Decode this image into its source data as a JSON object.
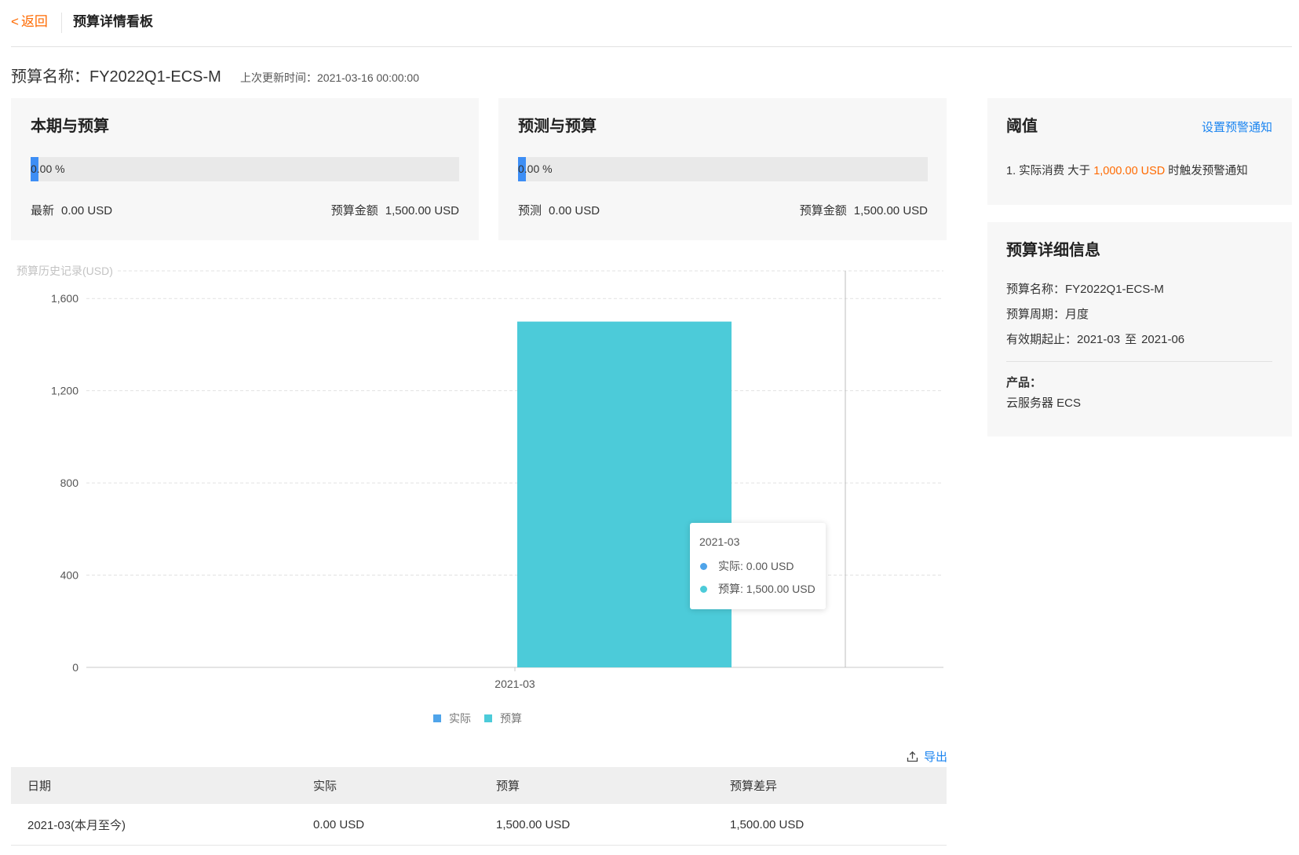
{
  "colors": {
    "brand_orange": "#ff6a00",
    "link_blue": "#1a84f0",
    "progress_blue": "#3d8ef5",
    "series_actual": "#4fa4ea",
    "series_budget": "#4ccbd9"
  },
  "header": {
    "back_chevron": "<",
    "back_label": "返回",
    "title": "预算详情看板"
  },
  "budget_summary": {
    "name_label": "预算名称：",
    "name": "FY2022Q1-ECS-M",
    "updated_label": "上次更新时间：",
    "updated_at": "2021-03-16 00:00:00"
  },
  "current_vs_budget": {
    "title": "本期与预算",
    "progress_percent": 0,
    "progress_text": "0.00 %",
    "left_label": "最新",
    "left_value": "0.00 USD",
    "right_label": "预算金额",
    "right_value": "1,500.00 USD"
  },
  "forecast_vs_budget": {
    "title": "预测与预算",
    "progress_percent": 0,
    "progress_text": "0.00 %",
    "left_label": "预测",
    "left_value": "0.00 USD",
    "right_label": "预算金额",
    "right_value": "1,500.00 USD"
  },
  "threshold": {
    "title": "阈值",
    "set_alert_link": "设置预警通知",
    "rule_prefix": "1. 实际消费 大于 ",
    "rule_amount": "1,000.00 USD",
    "rule_suffix": " 时触发预警通知"
  },
  "details": {
    "title": "预算详细信息",
    "name_label": "预算名称：",
    "name": "FY2022Q1-ECS-M",
    "period_label": "预算周期：",
    "period": "月度",
    "validity_label": "有效期起止：",
    "validity_start": "2021-03",
    "validity_sep": "至",
    "validity_end": "2021-06",
    "product_label": "产品：",
    "product": "云服务器 ECS"
  },
  "chart_data": {
    "type": "bar",
    "ylabel": "预算历史记录(USD)",
    "categories": [
      "2021-03"
    ],
    "series": [
      {
        "name": "实际",
        "values": [
          0
        ],
        "color": "#4fa4ea"
      },
      {
        "name": "预算",
        "values": [
          1500
        ],
        "color": "#4ccbd9"
      }
    ],
    "ylim": [
      0,
      1720
    ],
    "yticks": [
      0,
      400,
      800,
      1200,
      1600
    ],
    "ytick_labels": [
      "0",
      "400",
      "800",
      "1,200",
      "1,600"
    ],
    "grid": true,
    "legend": "bottom",
    "tooltip": {
      "title": "2021-03",
      "items": [
        "实际: 0.00 USD",
        "预算: 1,500.00 USD"
      ]
    }
  },
  "export_label": "导出",
  "table": {
    "columns": [
      "日期",
      "实际",
      "预算",
      "预算差异"
    ],
    "rows": [
      [
        "2021-03(本月至今)",
        "0.00 USD",
        "1,500.00 USD",
        "1,500.00 USD"
      ]
    ]
  }
}
